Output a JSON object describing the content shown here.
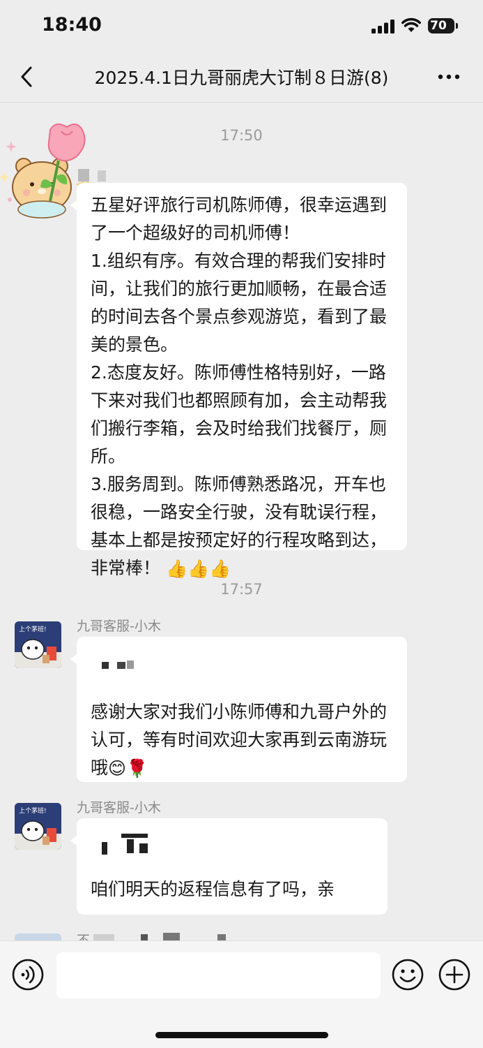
{
  "status_bar": {
    "time": "18:40",
    "battery": "70",
    "icons": [
      "signal-icon",
      "wifi-icon",
      "battery-icon"
    ]
  },
  "nav": {
    "title": "2025.4.1日九哥丽虎大订制８日游(8)",
    "back_icon": "chevron-left-icon",
    "more_icon": "more-dots-icon"
  },
  "messages": [
    {
      "timestamp": "17:50",
      "sender": "",
      "avatar": "bear-flower-avatar",
      "text": "五星好评旅行司机陈师傅，很幸运遇到了一个超级好的司机师傅！\n1.组织有序。有效合理的帮我们安排时间，让我们的旅行更加顺畅，在最合适的时间去各个景点参观游览，看到了最美的景色。\n2.态度友好。陈师傅性格特别好，一路下来对我们也都照顾有加，会主动帮我们搬行李箱，会及时给我们找餐厅，厕所。\n3.服务周到。陈师傅熟悉路况，开车也很稳，一路安全行驶，没有耽误行程，基本上都是按预定好的行程攻略到达，非常棒！",
      "emoji": "👍👍👍"
    },
    {
      "timestamp": "17:57",
      "sender": "九哥客服-小木",
      "avatar": "cat-avatar",
      "text": "感谢大家对我们小陈师傅和九哥户外的认可，等有时间欢迎大家再到云南游玩哦",
      "emoji": "😊🌹"
    },
    {
      "sender": "九哥客服-小木",
      "avatar": "cat-avatar",
      "text": "咱们明天的返程信息有了吗，亲"
    },
    {
      "sender": "不"
    }
  ],
  "input_bar": {
    "placeholder": "",
    "voice_icon": "voice-icon",
    "emoji_icon": "smiley-icon",
    "plus_icon": "plus-icon"
  },
  "colors": {
    "background": "#ededed",
    "bubble": "#ffffff",
    "name": "#8a8a8a",
    "timestamp": "#9a9a9a"
  }
}
